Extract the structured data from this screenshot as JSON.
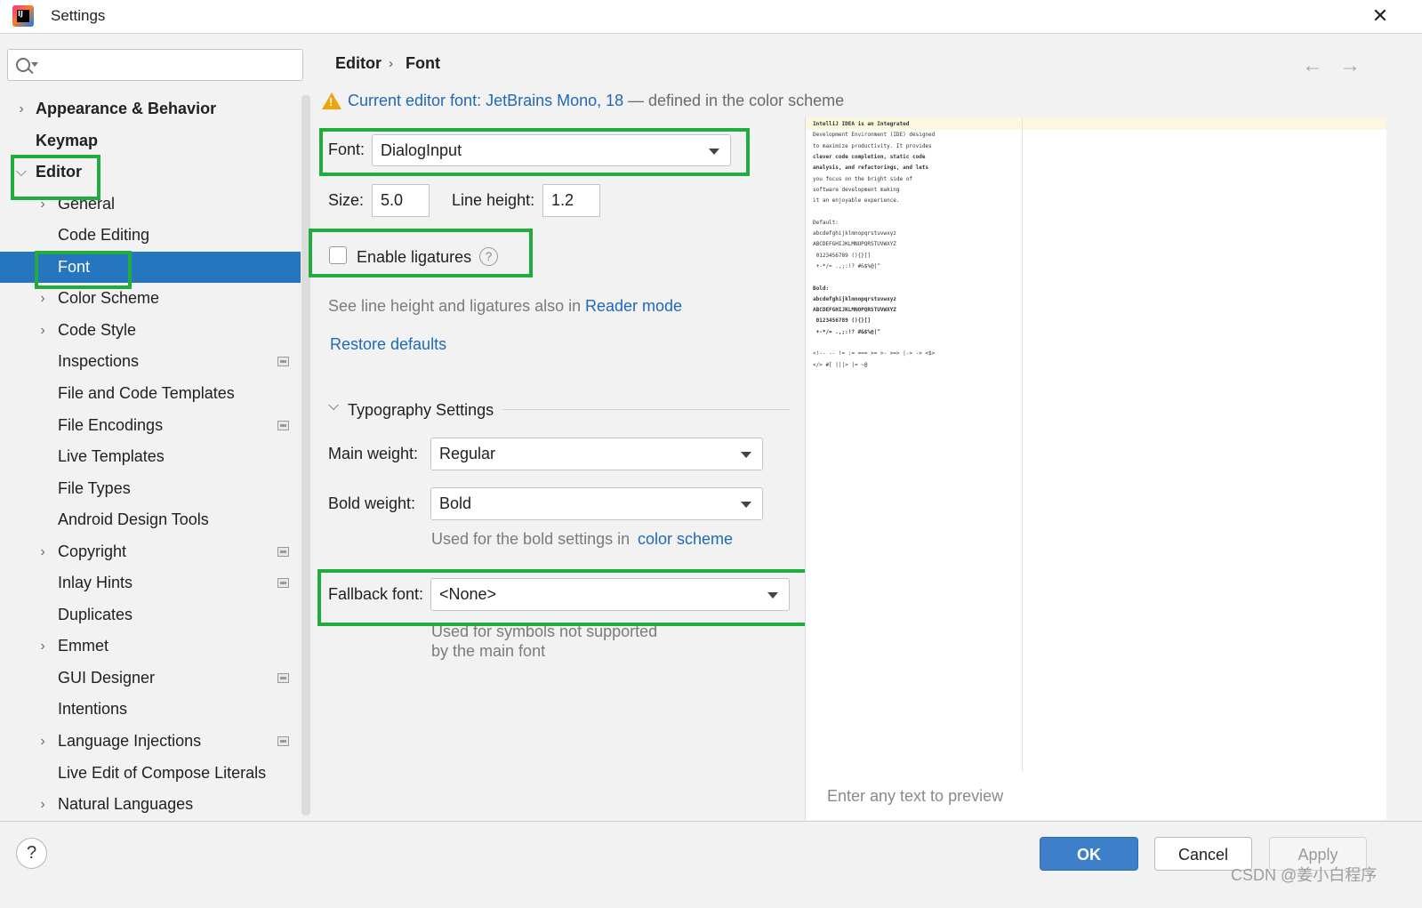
{
  "window": {
    "title": "Settings",
    "app_icon_text": "IJ"
  },
  "colors": {
    "accent": "#2675bf",
    "link": "#2069b6",
    "highlight_box": "#21ad3e",
    "warning": "#f0a30a",
    "ok_button": "#3d7fc8"
  },
  "search": {
    "placeholder": "",
    "icon": "search-icon"
  },
  "sidebar": {
    "items": [
      {
        "label": "Appearance & Behavior",
        "expandable": true,
        "expanded": false,
        "bold": true
      },
      {
        "label": "Keymap",
        "expandable": false,
        "bold": true
      },
      {
        "label": "Editor",
        "expandable": true,
        "expanded": true,
        "bold": true
      },
      {
        "label": "General",
        "expandable": true
      },
      {
        "label": "Code Editing",
        "expandable": false
      },
      {
        "label": "Font",
        "expandable": false,
        "selected": true
      },
      {
        "label": "Color Scheme",
        "expandable": true
      },
      {
        "label": "Code Style",
        "expandable": true
      },
      {
        "label": "Inspections",
        "project_icon": true
      },
      {
        "label": "File and Code Templates"
      },
      {
        "label": "File Encodings",
        "project_icon": true
      },
      {
        "label": "Live Templates"
      },
      {
        "label": "File Types"
      },
      {
        "label": "Android Design Tools"
      },
      {
        "label": "Copyright",
        "expandable": true,
        "project_icon": true
      },
      {
        "label": "Inlay Hints",
        "project_icon": true
      },
      {
        "label": "Duplicates"
      },
      {
        "label": "Emmet",
        "expandable": true
      },
      {
        "label": "GUI Designer",
        "project_icon": true
      },
      {
        "label": "Intentions"
      },
      {
        "label": "Language Injections",
        "expandable": true,
        "project_icon": true
      },
      {
        "label": "Live Edit of Compose Literals"
      },
      {
        "label": "Natural Languages",
        "expandable": true
      }
    ]
  },
  "breadcrumb": {
    "parent": "Editor",
    "separator": "›",
    "current": "Font",
    "back_icon": "←",
    "forward_icon": "→"
  },
  "warning": {
    "link_text": "Current editor font: JetBrains Mono, 18",
    "rest_text": "— defined in the color scheme"
  },
  "font_settings": {
    "font_label": "Font:",
    "font_value": "DialogInput",
    "size_label": "Size:",
    "size_value": "5.0",
    "line_height_label": "Line height:",
    "line_height_value": "1.2",
    "ligatures_label": "Enable ligatures",
    "ligatures_checked": false,
    "help_glyph": "?",
    "reader_mode_prefix": "See line height and ligatures also in",
    "reader_mode_link": "Reader mode",
    "restore_defaults": "Restore defaults"
  },
  "typography": {
    "section_title": "Typography Settings",
    "main_weight_label": "Main weight:",
    "main_weight_value": "Regular",
    "bold_weight_label": "Bold weight:",
    "bold_weight_value": "Bold",
    "bold_hint_prefix": "Used for the bold settings in",
    "bold_hint_link": "color scheme",
    "fallback_label": "Fallback font:",
    "fallback_value": "<None>",
    "fallback_hint_line1": "Used for symbols not supported",
    "fallback_hint_line2": "by the main font"
  },
  "preview": {
    "lines": [
      "IntelliJ IDEA is an Integrated",
      "Development Environment (IDE) designed",
      "to maximize productivity. It provides",
      "clever code completion, static code",
      "analysis, and refactorings, and lets",
      "you focus on the bright side of",
      "software development making",
      "it an enjoyable experience.",
      "",
      "Default:",
      "abcdefghijklmnopqrstuvwxyz",
      "ABCDEFGHIJKLMNOPQRSTUVWXYZ",
      " 0123456789 (){}[]",
      " +-*/= .,;:!? #&$%@|^",
      "",
      "Bold:",
      "abcdefghijklmnopqrstuvwxyz",
      "ABCDEFGHIJKLMNOPQRSTUVWXYZ",
      " 0123456789 (){}[]",
      " +-*/= .,;:!? #&$%@|^",
      "",
      "<!-- -- != := === >= >- >=> |-> -> <$>",
      "</> #[ |||> |= ~@"
    ],
    "hint": "Enter any text to preview"
  },
  "footer": {
    "help": "?",
    "ok": "OK",
    "cancel": "Cancel",
    "apply": "Apply"
  },
  "watermark": "CSDN @姜小白程序"
}
